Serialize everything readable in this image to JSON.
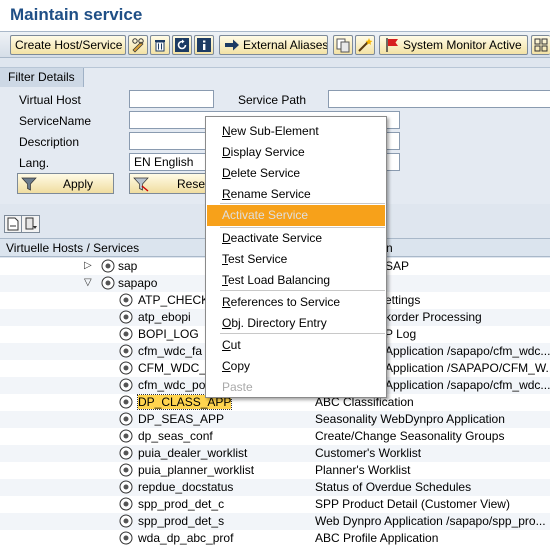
{
  "page_title": "Maintain service",
  "toolbar": {
    "create_host_service": "Create Host/Service",
    "external_aliases": "External Aliases",
    "system_monitor_active": "System Monitor Active"
  },
  "filter": {
    "tab_label": "Filter Details",
    "virtual_host_label": "Virtual Host",
    "virtual_host_value": "",
    "service_path_label": "Service Path",
    "service_path_value": "",
    "service_name_label": "ServiceName",
    "service_name_value": "",
    "description_label": "Description",
    "description_value": "",
    "lang_label": "Lang.",
    "lang_value": "EN English",
    "apply_label": "Apply",
    "reset_label": "Reset"
  },
  "tree": {
    "col_hosts": "Virtuelle Hosts / Services",
    "col_desc_fragment": "n",
    "nodes": [
      {
        "label": "sap",
        "desc": "SAP"
      },
      {
        "label": "sapapo",
        "desc": ""
      },
      {
        "label": "ATP_CHECKS",
        "desc": "ettings"
      },
      {
        "label": "atp_ebopi",
        "desc": "korder Processing"
      },
      {
        "label": "BOPI_LOG",
        "desc": "P Log"
      },
      {
        "label": "cfm_wdc_fa",
        "desc": "Application /sapapo/cfm_wdc..."
      },
      {
        "label": "CFM_WDC_FA",
        "desc": "Application /SAPAPO/CFM_W..."
      },
      {
        "label": "cfm_wdc_po",
        "desc": "Application /sapapo/cfm_wdc..."
      },
      {
        "label": "DP_CLASS_APP",
        "desc": "ABC Classification"
      },
      {
        "label": "DP_SEAS_APP",
        "desc": "Seasonality WebDynpro Application"
      },
      {
        "label": "dp_seas_conf",
        "desc": "Create/Change Seasonality Groups"
      },
      {
        "label": "puia_dealer_worklist",
        "desc": "Customer's Worklist"
      },
      {
        "label": "puia_planner_worklist",
        "desc": "Planner's Worklist"
      },
      {
        "label": "repdue_docstatus",
        "desc": "Status of Overdue Schedules"
      },
      {
        "label": "spp_prod_det_c",
        "desc": "SPP Product Detail (Customer View)"
      },
      {
        "label": "spp_prod_det_s",
        "desc": "Web Dynpro Application /sapapo/spp_pro..."
      },
      {
        "label": "wda_dp_abc_prof",
        "desc": "ABC Profile Application"
      }
    ]
  },
  "menu": {
    "new_sub_element": {
      "u": "N",
      "rest": "ew Sub-Element"
    },
    "display_service": {
      "u": "D",
      "rest": "isplay Service"
    },
    "delete_service": {
      "u": "D",
      "rest": "elete Service"
    },
    "rename_service": {
      "u": "R",
      "rest": "ename Service"
    },
    "activate_service": "Activate Service",
    "deactivate_service": {
      "u": "D",
      "rest": "eactivate Service"
    },
    "test_service": {
      "u": "T",
      "rest": "est Service"
    },
    "test_load_balancing": {
      "u": "T",
      "rest": "est Load Balancing"
    },
    "references_to_service": {
      "u": "R",
      "rest": "eferences to Service"
    },
    "obj_directory_entry": {
      "u": "O",
      "rest": "bj. Directory Entry"
    },
    "cut": {
      "u": "C",
      "rest": "ut"
    },
    "copy": {
      "u": "C",
      "rest": "opy"
    },
    "paste": "Paste"
  },
  "colors": {
    "title": "#1f4f86",
    "menu_highlight": "#f7a11a",
    "selection": "#ffd44f"
  }
}
